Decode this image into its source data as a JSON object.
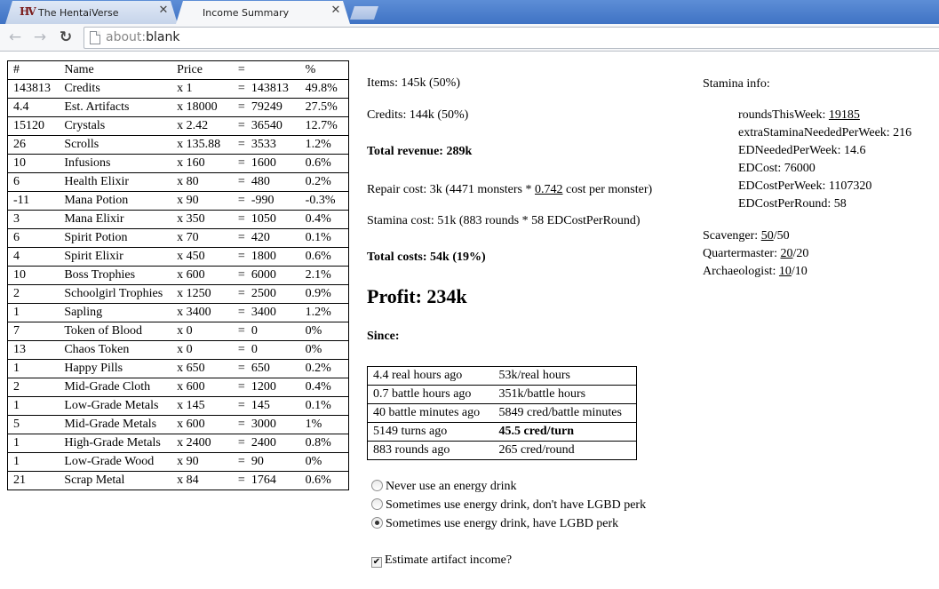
{
  "browser": {
    "tabs": [
      {
        "title": "The HentaiVerse",
        "favicon": "HV",
        "active": false
      },
      {
        "title": "Income Summary",
        "active": true
      }
    ],
    "url_scheme": "about:",
    "url_rest": "blank"
  },
  "items_table": {
    "headers": [
      "#",
      "Name",
      "Price",
      "=",
      "%"
    ],
    "rows": [
      {
        "qty": "143813",
        "name": "Credits",
        "price": "x 1",
        "eq": "=",
        "total": "143813",
        "pct": "49.8%"
      },
      {
        "qty": "4.4",
        "name": "Est. Artifacts",
        "price": "x 18000",
        "eq": "=",
        "total": "79249",
        "pct": "27.5%"
      },
      {
        "qty": "15120",
        "name": "Crystals",
        "price": "x 2.42",
        "eq": "=",
        "total": "36540",
        "pct": "12.7%"
      },
      {
        "qty": "26",
        "name": "Scrolls",
        "price": "x 135.88",
        "eq": "=",
        "total": "3533",
        "pct": "1.2%"
      },
      {
        "qty": "10",
        "name": "Infusions",
        "price": "x 160",
        "eq": "=",
        "total": "1600",
        "pct": "0.6%"
      },
      {
        "qty": "6",
        "name": "Health Elixir",
        "price": "x 80",
        "eq": "=",
        "total": "480",
        "pct": "0.2%"
      },
      {
        "qty": "-11",
        "name": "Mana Potion",
        "price": "x 90",
        "eq": "=",
        "total": "-990",
        "pct": "-0.3%"
      },
      {
        "qty": "3",
        "name": "Mana Elixir",
        "price": "x 350",
        "eq": "=",
        "total": "1050",
        "pct": "0.4%"
      },
      {
        "qty": "6",
        "name": "Spirit Potion",
        "price": "x 70",
        "eq": "=",
        "total": "420",
        "pct": "0.1%"
      },
      {
        "qty": "4",
        "name": "Spirit Elixir",
        "price": "x 450",
        "eq": "=",
        "total": "1800",
        "pct": "0.6%"
      },
      {
        "qty": "10",
        "name": "Boss Trophies",
        "price": "x 600",
        "eq": "=",
        "total": "6000",
        "pct": "2.1%"
      },
      {
        "qty": "2",
        "name": "Schoolgirl Trophies",
        "price": "x 1250",
        "eq": "=",
        "total": "2500",
        "pct": "0.9%"
      },
      {
        "qty": "1",
        "name": "Sapling",
        "price": "x 3400",
        "eq": "=",
        "total": "3400",
        "pct": "1.2%"
      },
      {
        "qty": "7",
        "name": "Token of Blood",
        "price": "x 0",
        "eq": "=",
        "total": "0",
        "pct": "0%"
      },
      {
        "qty": "13",
        "name": "Chaos Token",
        "price": "x 0",
        "eq": "=",
        "total": "0",
        "pct": "0%"
      },
      {
        "qty": "1",
        "name": "Happy Pills",
        "price": "x 650",
        "eq": "=",
        "total": "650",
        "pct": "0.2%"
      },
      {
        "qty": "2",
        "name": "Mid-Grade Cloth",
        "price": "x 600",
        "eq": "=",
        "total": "1200",
        "pct": "0.4%"
      },
      {
        "qty": "1",
        "name": "Low-Grade Metals",
        "price": "x 145",
        "eq": "=",
        "total": "145",
        "pct": "0.1%"
      },
      {
        "qty": "5",
        "name": "Mid-Grade Metals",
        "price": "x 600",
        "eq": "=",
        "total": "3000",
        "pct": "1%"
      },
      {
        "qty": "1",
        "name": "High-Grade Metals",
        "price": "x 2400",
        "eq": "=",
        "total": "2400",
        "pct": "0.8%"
      },
      {
        "qty": "1",
        "name": "Low-Grade Wood",
        "price": "x 90",
        "eq": "=",
        "total": "90",
        "pct": "0%"
      },
      {
        "qty": "21",
        "name": "Scrap Metal",
        "price": "x 84",
        "eq": "=",
        "total": "1764",
        "pct": "0.6%"
      }
    ]
  },
  "summary": {
    "items": "Items: 145k (50%)",
    "credits": "Credits: 144k (50%)",
    "total_revenue": "Total revenue: 289k",
    "repair_prefix": "Repair cost: 3k (4471 monsters * ",
    "repair_link": "0.742",
    "repair_suffix": " cost per monster)",
    "stamina_cost": "Stamina cost: 51k (883 rounds * 58 EDCostPerRound)",
    "total_costs": "Total costs: 54k (19%)",
    "profit": "Profit: 234k",
    "since": "Since:"
  },
  "since_table": [
    {
      "ago": "4.4 real hours ago",
      "rate": "53k/real hours",
      "bold": false
    },
    {
      "ago": "0.7 battle hours ago",
      "rate": "351k/battle hours",
      "bold": false
    },
    {
      "ago": "40 battle minutes ago",
      "rate": "5849 cred/battle minutes",
      "bold": false
    },
    {
      "ago": "5149 turns ago",
      "rate": "45.5 cred/turn",
      "bold": true
    },
    {
      "ago": "883 rounds ago",
      "rate": "265 cred/round",
      "bold": false
    }
  ],
  "options": {
    "radios": [
      {
        "label": "Never use an energy drink",
        "checked": false
      },
      {
        "label": "Sometimes use energy drink, don't have LGBD perk",
        "checked": false
      },
      {
        "label": "Sometimes use energy drink, have LGBD perk",
        "checked": true
      }
    ],
    "checkbox_label": "Estimate artifact income?",
    "checkbox_checked": true
  },
  "stamina_info": {
    "title": "Stamina info:",
    "rounds_label": "roundsThisWeek: ",
    "rounds_value": "19185",
    "extra": "extraStaminaNeededPerWeek: 216",
    "ed_needed": "EDNeededPerWeek: 14.6",
    "ed_cost": "EDCost: 76000",
    "ed_cost_week": "EDCostPerWeek: 1107320",
    "ed_cost_round": "EDCostPerRound: 58"
  },
  "perks": [
    {
      "label": "Scavenger: ",
      "value": "50",
      "max": "/50"
    },
    {
      "label": "Quartermaster: ",
      "value": "20",
      "max": "/20"
    },
    {
      "label": "Archaeologist: ",
      "value": "10",
      "max": "/10"
    }
  ]
}
